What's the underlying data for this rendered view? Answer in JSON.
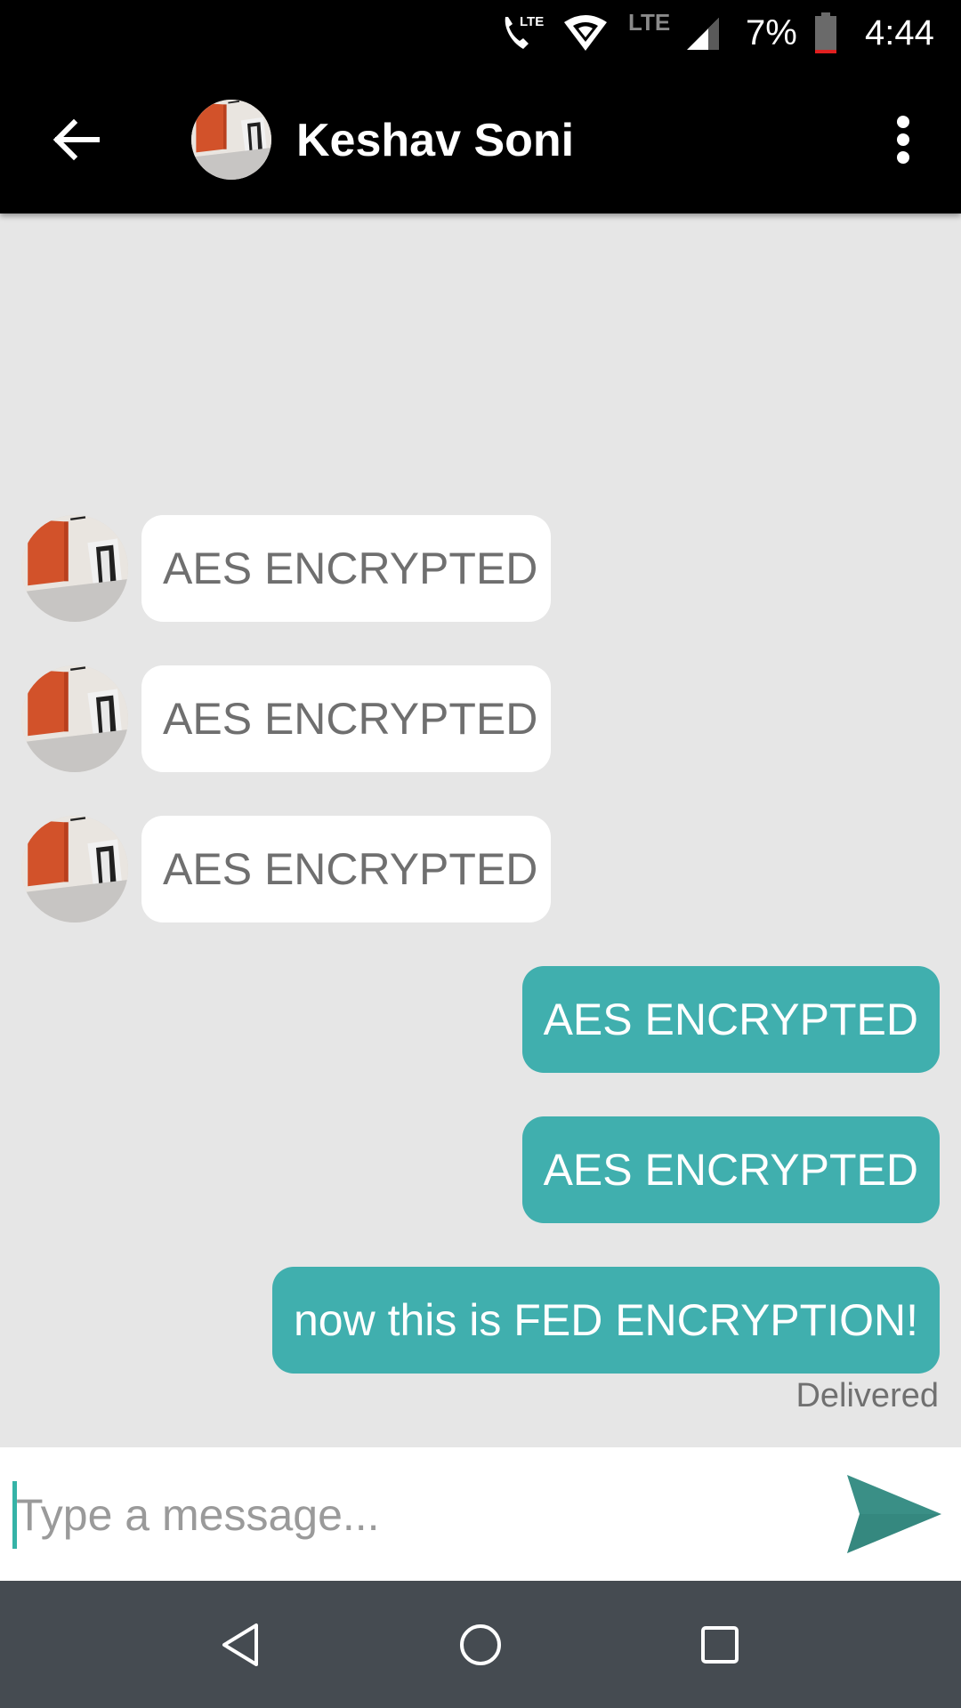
{
  "status_bar": {
    "lte_call": "LTE",
    "lte_label": "LTE",
    "battery_percent": "7%",
    "time": "4:44",
    "icons": [
      "call-icon",
      "wifi-icon",
      "signal-icon",
      "battery-icon"
    ]
  },
  "header": {
    "contact_name": "Keshav Soni",
    "icons": [
      "back-arrow-icon",
      "more-vert-icon"
    ]
  },
  "messages": [
    {
      "direction": "incoming",
      "text": "AES ENCRYPTED"
    },
    {
      "direction": "incoming",
      "text": "AES ENCRYPTED"
    },
    {
      "direction": "incoming",
      "text": "AES ENCRYPTED"
    },
    {
      "direction": "outgoing",
      "text": "AES ENCRYPTED"
    },
    {
      "direction": "outgoing",
      "text": "AES ENCRYPTED"
    },
    {
      "direction": "outgoing",
      "text": "now this is FED ENCRYPTION!"
    }
  ],
  "last_message_status": "Delivered",
  "composer": {
    "placeholder": "Type a message...",
    "value": ""
  },
  "colors": {
    "outgoing_bubble": "#40afae",
    "incoming_bubble": "#ffffff",
    "send_icon": "#3a8f86",
    "nav_bar": "#454b51"
  },
  "nav_icons": [
    "back-triangle-icon",
    "home-circle-icon",
    "recents-square-icon"
  ]
}
